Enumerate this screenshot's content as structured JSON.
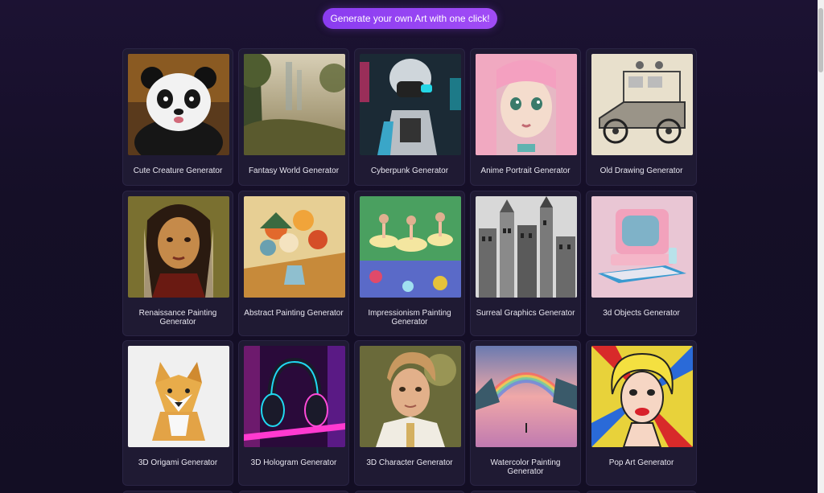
{
  "header": {
    "cta_label": "Generate your own Art with one click!"
  },
  "generators": [
    {
      "label": "Cute Creature Generator",
      "image": "panda-illustration"
    },
    {
      "label": "Fantasy World Generator",
      "image": "misty-fantasy-landscape"
    },
    {
      "label": "Cyberpunk Generator",
      "image": "cyberpunk-robot"
    },
    {
      "label": "Anime Portrait Generator",
      "image": "anime-girl-portrait"
    },
    {
      "label": "Old Drawing Generator",
      "image": "vintage-car-sketch"
    },
    {
      "label": "Renaissance Painting Generator",
      "image": "renaissance-portrait"
    },
    {
      "label": "Abstract Painting Generator",
      "image": "flower-vase-painting"
    },
    {
      "label": "Impressionism Painting Generator",
      "image": "ballet-dancers-painting"
    },
    {
      "label": "Surreal Graphics Generator",
      "image": "city-ink-drawing"
    },
    {
      "label": "3d Objects Generator",
      "image": "retro-computer-3d"
    },
    {
      "label": "3D Origami Generator",
      "image": "origami-dog"
    },
    {
      "label": "3D Hologram Generator",
      "image": "neon-headphones"
    },
    {
      "label": "3D Character Generator",
      "image": "3d-character-portrait"
    },
    {
      "label": "Watercolor Painting Generator",
      "image": "watercolor-rainbow-landscape"
    },
    {
      "label": "Pop Art Generator",
      "image": "pop-art-portrait"
    }
  ],
  "colors": {
    "background": "#150f26",
    "card": "#1f1a33",
    "accent": "#9146f4"
  }
}
